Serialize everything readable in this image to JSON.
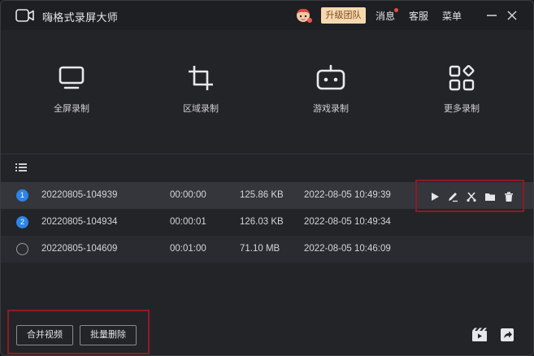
{
  "titlebar": {
    "app_title": "嗨格式录屏大师",
    "upgrade_label": "升级团队",
    "messages_label": "消息",
    "support_label": "客服",
    "menu_label": "菜单"
  },
  "modes": [
    {
      "label": "全屏录制",
      "icon": "monitor-icon"
    },
    {
      "label": "区域录制",
      "icon": "crop-icon"
    },
    {
      "label": "游戏录制",
      "icon": "gamepad-icon"
    },
    {
      "label": "更多录制",
      "icon": "apps-grid-icon"
    }
  ],
  "recordings": [
    {
      "index": "1",
      "name": "20220805-104939",
      "duration": "00:00:00",
      "size": "125.86 KB",
      "time": "2022-08-05 10:49:39"
    },
    {
      "index": "2",
      "name": "20220805-104934",
      "duration": "00:00:01",
      "size": "126.03 KB",
      "time": "2022-08-05 10:49:34"
    },
    {
      "index": "",
      "name": "20220805-104609",
      "duration": "00:01:00",
      "size": "71.10 MB",
      "time": "2022-08-05 10:46:09"
    }
  ],
  "bottom": {
    "merge_label": "合并视频",
    "batch_delete_label": "批量删除"
  },
  "colors": {
    "accent": "#2d84e8",
    "highlight_box": "#8b1c24",
    "upgrade_bg": "#f6d8b0"
  }
}
